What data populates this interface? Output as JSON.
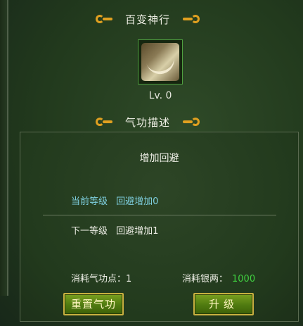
{
  "header": {
    "title": "百变神行"
  },
  "skill": {
    "icon": "feather-skill-icon",
    "level_text": "Lv. 0"
  },
  "section": {
    "title": "气功描述"
  },
  "description": {
    "title": "增加回避",
    "current_label": "当前等级",
    "current_value": "回避增加0",
    "next_label": "下一等级",
    "next_value": "回避增加1"
  },
  "costs": {
    "qigong_label": "消耗气功点：",
    "qigong_value": "1",
    "silver_label": "消耗银两：",
    "silver_value": "1000"
  },
  "buttons": {
    "reset": "重置气功",
    "upgrade": "升级"
  },
  "colors": {
    "accent_gold": "#e0a020",
    "current_text": "#7fd0e0",
    "silver_value": "#40d040",
    "button_green": "#4f7a10"
  }
}
